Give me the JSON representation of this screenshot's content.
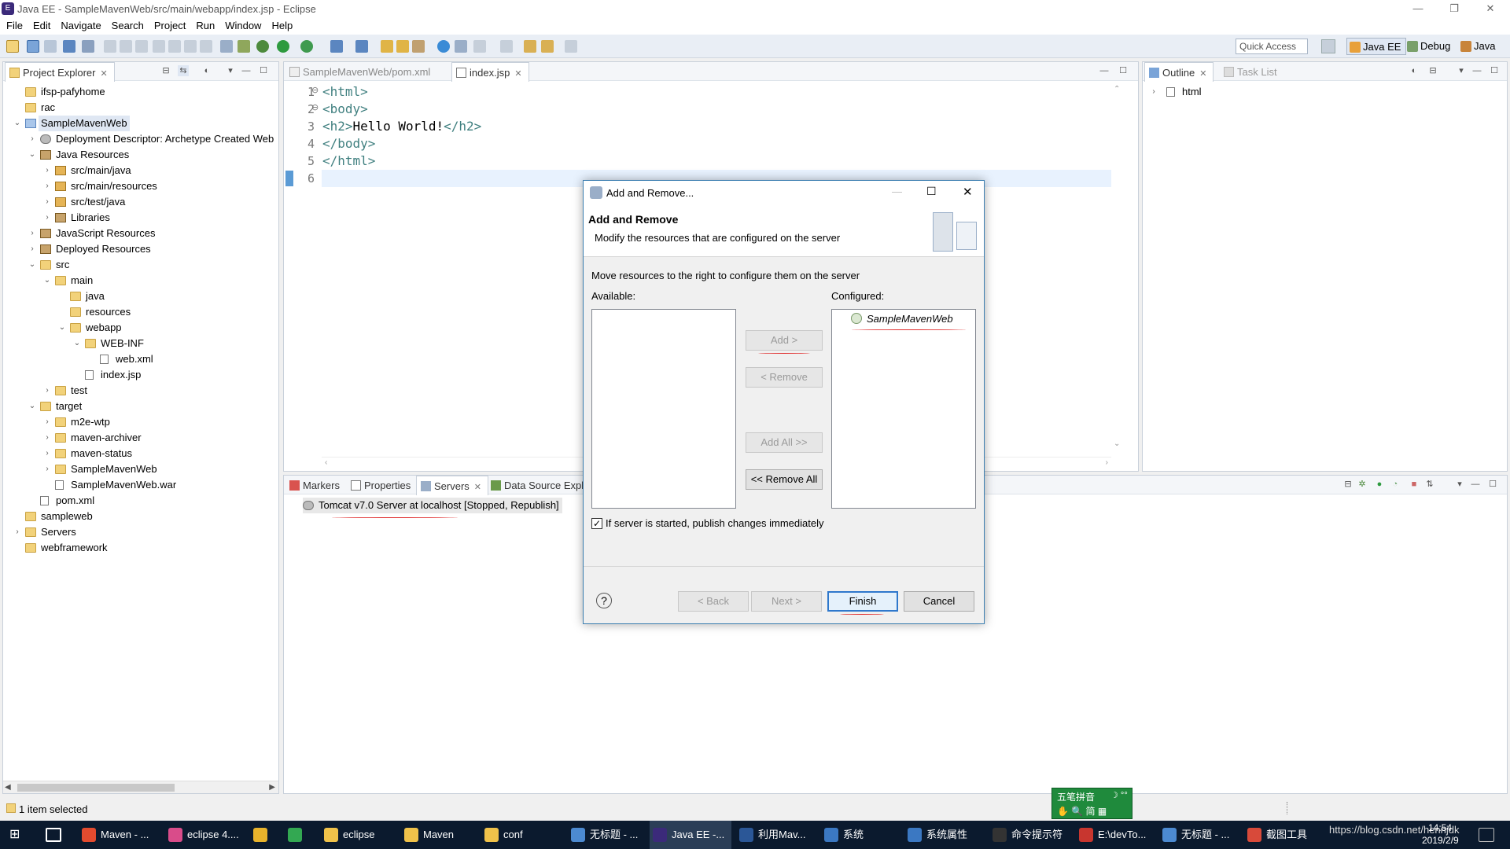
{
  "window": {
    "title": "Java EE - SampleMavenWeb/src/main/webapp/index.jsp - Eclipse",
    "minimize": "—",
    "restore": "❐",
    "close": "✕"
  },
  "menu": [
    "File",
    "Edit",
    "Navigate",
    "Search",
    "Project",
    "Run",
    "Window",
    "Help"
  ],
  "toolbar": {
    "quick_access_placeholder": "Quick Access",
    "perspectives": [
      "Java EE",
      "Debug",
      "Java"
    ]
  },
  "project_explorer": {
    "tab_label": "Project Explorer",
    "items": [
      {
        "label": "ifsp-pafyhome",
        "depth": 0,
        "icon": "project-folder-icon",
        "arrow": ""
      },
      {
        "label": "rac",
        "depth": 0,
        "icon": "project-folder-icon",
        "arrow": ""
      },
      {
        "label": "SampleMavenWeb",
        "depth": 0,
        "icon": "project-icon",
        "arrow": "v",
        "selected": true
      },
      {
        "label": "Deployment Descriptor: Archetype Created Web",
        "depth": 1,
        "icon": "descriptor-icon",
        "arrow": ">"
      },
      {
        "label": "Java Resources",
        "depth": 1,
        "icon": "java-resources-icon",
        "arrow": "v"
      },
      {
        "label": "src/main/java",
        "depth": 2,
        "icon": "package-folder-icon",
        "arrow": ">"
      },
      {
        "label": "src/main/resources",
        "depth": 2,
        "icon": "package-folder-icon",
        "arrow": ">"
      },
      {
        "label": "src/test/java",
        "depth": 2,
        "icon": "package-folder-icon",
        "arrow": ">"
      },
      {
        "label": "Libraries",
        "depth": 2,
        "icon": "library-icon",
        "arrow": ">"
      },
      {
        "label": "JavaScript Resources",
        "depth": 1,
        "icon": "js-resources-icon",
        "arrow": ">"
      },
      {
        "label": "Deployed Resources",
        "depth": 1,
        "icon": "deployed-resources-icon",
        "arrow": ">"
      },
      {
        "label": "src",
        "depth": 1,
        "icon": "folder-icon",
        "arrow": "v"
      },
      {
        "label": "main",
        "depth": 2,
        "icon": "folder-icon",
        "arrow": "v"
      },
      {
        "label": "java",
        "depth": 3,
        "icon": "folder-icon",
        "arrow": ""
      },
      {
        "label": "resources",
        "depth": 3,
        "icon": "folder-icon",
        "arrow": ""
      },
      {
        "label": "webapp",
        "depth": 3,
        "icon": "folder-icon",
        "arrow": "v"
      },
      {
        "label": "WEB-INF",
        "depth": 4,
        "icon": "folder-icon",
        "arrow": "v"
      },
      {
        "label": "web.xml",
        "depth": 5,
        "icon": "xml-file-icon",
        "arrow": ""
      },
      {
        "label": "index.jsp",
        "depth": 4,
        "icon": "jsp-file-icon",
        "arrow": ""
      },
      {
        "label": "test",
        "depth": 2,
        "icon": "folder-icon",
        "arrow": ">"
      },
      {
        "label": "target",
        "depth": 1,
        "icon": "folder-icon",
        "arrow": "v"
      },
      {
        "label": "m2e-wtp",
        "depth": 2,
        "icon": "folder-icon",
        "arrow": ">"
      },
      {
        "label": "maven-archiver",
        "depth": 2,
        "icon": "folder-icon",
        "arrow": ">"
      },
      {
        "label": "maven-status",
        "depth": 2,
        "icon": "folder-icon",
        "arrow": ">"
      },
      {
        "label": "SampleMavenWeb",
        "depth": 2,
        "icon": "folder-icon",
        "arrow": ">"
      },
      {
        "label": "SampleMavenWeb.war",
        "depth": 2,
        "icon": "war-file-icon",
        "arrow": ""
      },
      {
        "label": "pom.xml",
        "depth": 1,
        "icon": "maven-file-icon",
        "arrow": ""
      },
      {
        "label": "sampleweb",
        "depth": 0,
        "icon": "project-folder-icon",
        "arrow": ""
      },
      {
        "label": "Servers",
        "depth": 0,
        "icon": "servers-folder-icon",
        "arrow": ">"
      },
      {
        "label": "webframework",
        "depth": 0,
        "icon": "project-folder-icon",
        "arrow": ""
      }
    ]
  },
  "editor": {
    "tabs": [
      "SampleMavenWeb/pom.xml",
      "index.jsp"
    ],
    "line_numbers": [
      "1",
      "2",
      "3",
      "4",
      "5",
      "6"
    ],
    "fold_markers": [
      "⊖",
      "⊖"
    ],
    "lines": [
      {
        "tag_open": "<html>",
        "text": "",
        "tag_close": ""
      },
      {
        "tag_open": "<body>",
        "text": "",
        "tag_close": ""
      },
      {
        "tag_open": "<h2>",
        "text": "Hello World!",
        "tag_close": "</h2>"
      },
      {
        "tag_open": "</body>",
        "text": "",
        "tag_close": ""
      },
      {
        "tag_open": "</html>",
        "text": "",
        "tag_close": ""
      },
      {
        "tag_open": "",
        "text": "",
        "tag_close": ""
      }
    ]
  },
  "outline": {
    "tabs": [
      "Outline",
      "Task List"
    ],
    "items": [
      "html"
    ]
  },
  "bottom_panel": {
    "tabs": [
      "Markers",
      "Properties",
      "Servers",
      "Data Source Expl"
    ],
    "server_entry": "Tomcat v7.0 Server at localhost  [Stopped, Republish]"
  },
  "dialog": {
    "title": "Add and Remove...",
    "heading": "Add and Remove",
    "description": "Modify the resources that are configured on the server",
    "instruction": "Move resources to the right to configure them on the server",
    "available_label": "Available:",
    "configured_label": "Configured:",
    "available_items": [],
    "configured_items": [
      "SampleMavenWeb"
    ],
    "buttons": {
      "add": "Add >",
      "remove": "< Remove",
      "add_all": "Add All >>",
      "remove_all": "<< Remove All",
      "back": "< Back",
      "next": "Next >",
      "finish": "Finish",
      "cancel": "Cancel"
    },
    "publish_checkbox": "If server is started, publish changes immediately",
    "publish_checked": true,
    "help": "?"
  },
  "status": {
    "text": "1 item selected"
  },
  "ime": {
    "label": "五笔拼音"
  },
  "taskbar": {
    "items": [
      {
        "label": "Maven - ...",
        "color": "#e34b2f"
      },
      {
        "label": "eclipse 4....",
        "color": "#d94c8a"
      },
      {
        "label": "",
        "color": "#e8b32c"
      },
      {
        "label": "",
        "color": "#33a852"
      },
      {
        "label": "eclipse",
        "color": "#f0c24a"
      },
      {
        "label": "Maven",
        "color": "#f0c24a"
      },
      {
        "label": "conf",
        "color": "#f0c24a"
      },
      {
        "label": "无标题 - ...",
        "color": "#4c8ad1"
      },
      {
        "label": "Java EE -...",
        "color": "#3b2a7a"
      },
      {
        "label": "利用Mav...",
        "color": "#2b5797"
      },
      {
        "label": "系统",
        "color": "#3b78c2"
      },
      {
        "label": "系统属性",
        "color": "#3b78c2"
      },
      {
        "label": "命令提示符",
        "color": "#333333"
      },
      {
        "label": "E:\\devTo...",
        "color": "#c8362f"
      },
      {
        "label": "无标题 - ...",
        "color": "#4c8ad1"
      },
      {
        "label": "截图工具",
        "color": "#d84a3a"
      }
    ],
    "tray_text": "https://blog.csdn.net/hennjdk",
    "time": "14:54",
    "date": "2019/2/9"
  }
}
